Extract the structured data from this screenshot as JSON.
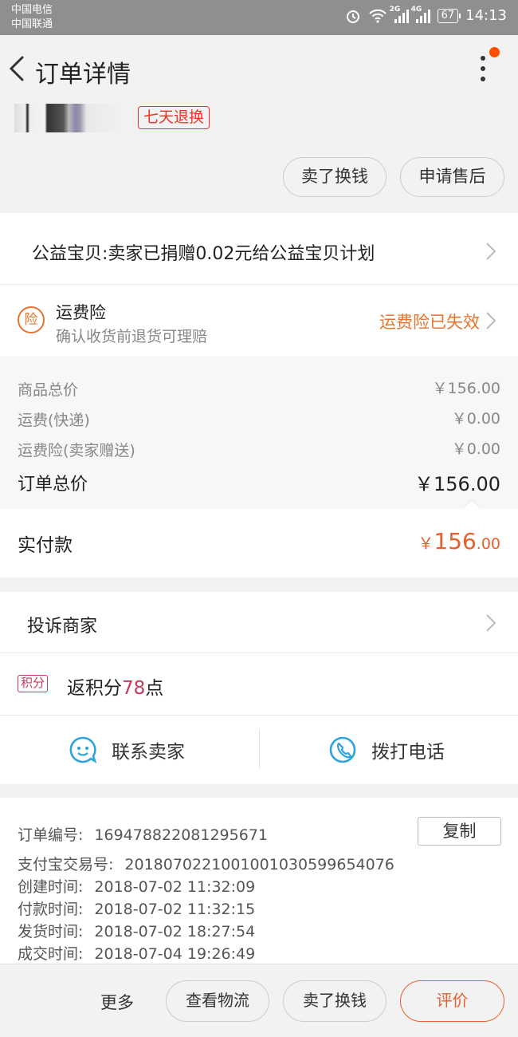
{
  "status_bar": {
    "carrier1": "中国电信",
    "carrier2": "中国联通",
    "net1": "2G",
    "net2": "4G",
    "battery": "67",
    "time": "14:13"
  },
  "nav": {
    "title": "订单详情",
    "back_icon": "chevron-left-icon",
    "more_icon": "vertical-dots-icon"
  },
  "product": {
    "tag": "七天退换"
  },
  "action_pills": [
    "卖了换钱",
    "申请售后"
  ],
  "charity": {
    "text": "公益宝贝:卖家已捐赠0.02元给公益宝贝计划"
  },
  "insurance": {
    "badge": "险",
    "title": "运费险",
    "subtitle": "确认收货前退货可理赔",
    "status": "运费险已失效"
  },
  "prices": [
    {
      "label": "商品总价",
      "value": "￥156.00"
    },
    {
      "label": "运费(快递)",
      "value": "￥0.00"
    },
    {
      "label": "运费险(卖家赠送)",
      "value": "￥0.00"
    }
  ],
  "order_total": {
    "label": "订单总价",
    "value": "￥156.00"
  },
  "paid": {
    "label": "实付款",
    "currency": "￥",
    "integer": "156",
    "decimal": ".00"
  },
  "complaint": {
    "label": "投诉商家"
  },
  "points": {
    "badge": "积分",
    "prefix": "返积分",
    "value": "78",
    "suffix": "点"
  },
  "contact": {
    "seller": "联系卖家",
    "phone": "拨打电话"
  },
  "order_info": {
    "copy_label": "复制",
    "rows": [
      {
        "key": "订单编号:",
        "value": "169478822081295671"
      },
      {
        "key": "支付宝交易号:",
        "value": "2018070221001001030599654076"
      },
      {
        "key": "创建时间:",
        "value": "2018-07-02 11:32:09"
      },
      {
        "key": "付款时间:",
        "value": "2018-07-02 11:32:15"
      },
      {
        "key": "发货时间:",
        "value": "2018-07-02 18:27:54"
      },
      {
        "key": "成交时间:",
        "value": "2018-07-04 19:26:49"
      }
    ]
  },
  "bottom_bar": {
    "more": "更多",
    "logistics": "查看物流",
    "sell": "卖了换钱",
    "rate": "评价"
  },
  "colors": {
    "accent": "#e6602d",
    "points": "#c33a5a",
    "contact_icon": "#2ba4e0"
  }
}
